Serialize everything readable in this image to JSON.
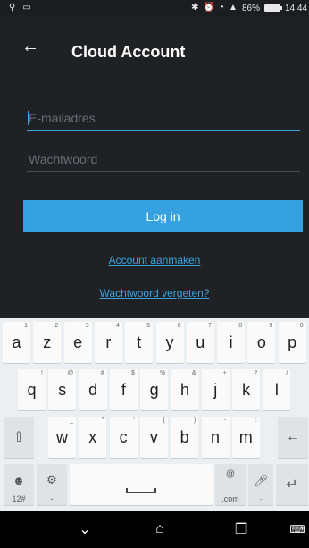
{
  "status_bar": {
    "battery_percent": "86%",
    "time": "14:44"
  },
  "app_bar": {
    "title": "Cloud Account"
  },
  "form": {
    "email_placeholder": "E-mailadres",
    "password_placeholder": "Wachtwoord",
    "login_label": "Log in",
    "create_account_label": "Account aanmaken",
    "forgot_password_label": "Wachtwoord vergeten?"
  },
  "keyboard": {
    "row1": [
      {
        "key": "a",
        "hint": "1"
      },
      {
        "key": "z",
        "hint": "2"
      },
      {
        "key": "e",
        "hint": "3"
      },
      {
        "key": "r",
        "hint": "4"
      },
      {
        "key": "t",
        "hint": "5"
      },
      {
        "key": "y",
        "hint": "6"
      },
      {
        "key": "u",
        "hint": "7"
      },
      {
        "key": "i",
        "hint": "8"
      },
      {
        "key": "o",
        "hint": "9"
      },
      {
        "key": "p",
        "hint": "0"
      }
    ],
    "row2": [
      {
        "key": "q",
        "hint": "!"
      },
      {
        "key": "s",
        "hint": "@"
      },
      {
        "key": "d",
        "hint": "#"
      },
      {
        "key": "f",
        "hint": "$"
      },
      {
        "key": "g",
        "hint": "%"
      },
      {
        "key": "h",
        "hint": "&"
      },
      {
        "key": "j",
        "hint": "+"
      },
      {
        "key": "k",
        "hint": "?"
      },
      {
        "key": "l",
        "hint": "/"
      }
    ],
    "row3": [
      {
        "key": "w",
        "hint": "_"
      },
      {
        "key": "x",
        "hint": "\""
      },
      {
        "key": "c",
        "hint": "'"
      },
      {
        "key": "v",
        "hint": "("
      },
      {
        "key": "b",
        "hint": ")"
      },
      {
        "key": "n",
        "hint": "-"
      },
      {
        "key": "m",
        "hint": ":"
      }
    ],
    "symbols_label": "12#",
    "dotcom_label": ".com",
    "at_label": "@"
  },
  "colors": {
    "accent": "#35a2df",
    "background": "#1f2125",
    "keyboard": "#eceff1"
  },
  "icons": {
    "back": "arrow-left-icon",
    "shift": "shift-icon",
    "backspace": "backspace-icon",
    "enter": "enter-icon",
    "emoji": "emoji-icon",
    "settings": "settings-icon",
    "mic": "mic-icon",
    "nav_back": "chevron-down-icon",
    "nav_home": "home-icon",
    "nav_recents": "recents-icon",
    "nav_keyboard": "keyboard-icon"
  }
}
